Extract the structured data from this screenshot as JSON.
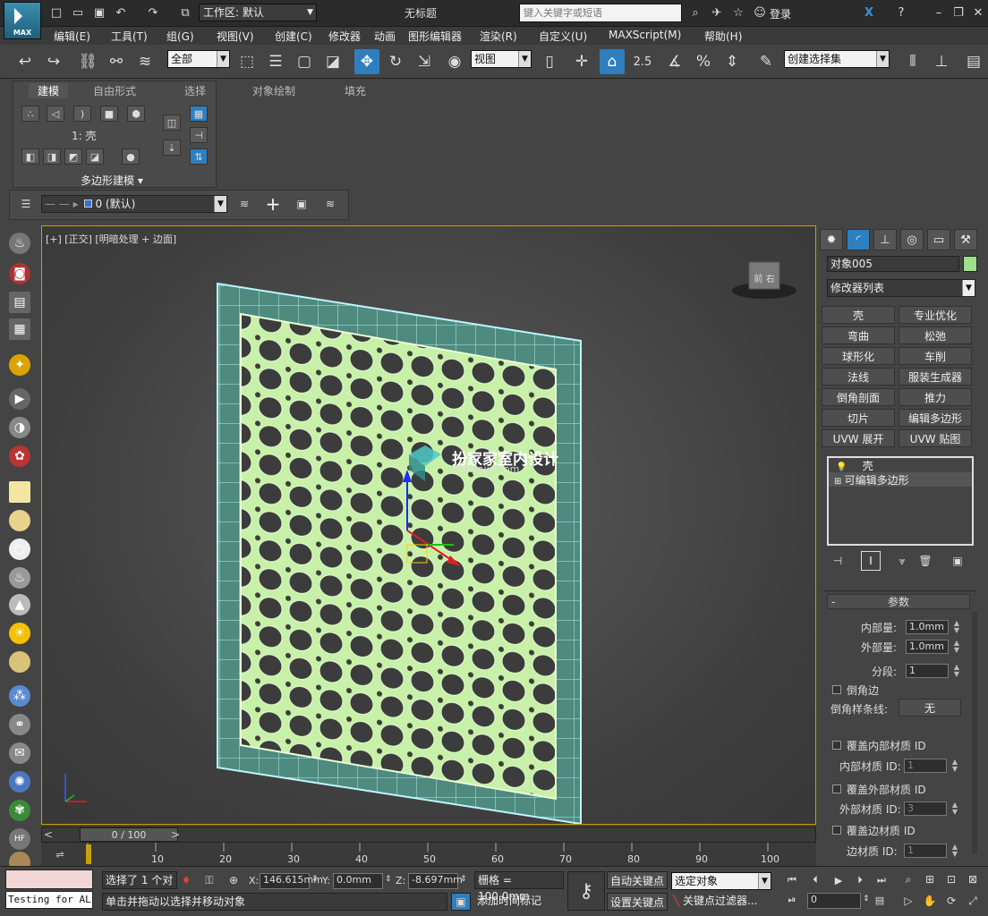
{
  "app": {
    "brand": "MAX",
    "doc_title": "无标题"
  },
  "quick_access": {
    "workspace_label": "工作区: 默认",
    "search_placeholder": "键入关键字或短语",
    "login": "登录"
  },
  "menu": [
    "编辑(E)",
    "工具(T)",
    "组(G)",
    "视图(V)",
    "创建(C)",
    "修改器",
    "动画",
    "图形编辑器",
    "渲染(R)",
    "自定义(U)",
    "MAXScript(M)",
    "帮助(H)"
  ],
  "toolbar": {
    "selection_filter": "全部",
    "ref_coord": "视图",
    "snap_value": "2.5",
    "named_selection": "创建选择集"
  },
  "ribbon": {
    "tabs": [
      "建模",
      "自由形式",
      "选择",
      "对象绘制",
      "填充"
    ],
    "active_tab": "建模",
    "level_label": "1: 壳",
    "panel_title": "多边形建模 ▾"
  },
  "layer": {
    "current": "0 (默认)"
  },
  "viewport": {
    "label": "[+] [正交] [明暗处理 + 边面]",
    "watermark_cn": "扮家家室内设计",
    "watermark_en": "banjiajia.com",
    "viewcube": "前 右"
  },
  "command_panel": {
    "object_name": "对象005",
    "modifier_list": "修改器列表",
    "modifier_buttons": [
      "壳",
      "专业优化",
      "弯曲",
      "松弛",
      "球形化",
      "车削",
      "法线",
      "服装生成器",
      "倒角剖面",
      "推力",
      "切片",
      "编辑多边形",
      "UVW 展开",
      "UVW 贴图"
    ],
    "stack": [
      "壳",
      "可编辑多边形"
    ],
    "params": {
      "rollout_title": "参数",
      "inner_label": "内部量:",
      "inner_value": "1.0mm",
      "outer_label": "外部量:",
      "outer_value": "1.0mm",
      "segments_label": "分段:",
      "segments_value": "1",
      "bevel_edges": "倒角边",
      "bevel_spline_label": "倒角样条线:",
      "bevel_spline_value": "无",
      "override_inner": "覆盖内部材质 ID",
      "inner_mat_label": "内部材质 ID:",
      "inner_mat_value": "1",
      "override_outer": "覆盖外部材质 ID",
      "outer_mat_label": "外部材质 ID:",
      "outer_mat_value": "3",
      "override_edge": "覆盖边材质 ID",
      "edge_mat_label": "边材质 ID:",
      "edge_mat_value": "1"
    }
  },
  "timeline": {
    "frame_label": "0 / 100",
    "ticks": [
      "10",
      "20",
      "30",
      "40",
      "50",
      "60",
      "70",
      "80",
      "90",
      "100"
    ]
  },
  "status": {
    "maxscript_text": "Testing for AL(",
    "selection_info": "选择了 1 个对",
    "prompt": "单击并拖动以选择并移动对象",
    "x_value": "146.615mm",
    "y_value": "0.0mm",
    "z_value": "-8.697mm",
    "grid": "栅格 = 100.0mm",
    "add_time_tag": "添加时间标记",
    "auto_key": "自动关键点",
    "set_key": "设置关键点",
    "key_mode": "选定对象",
    "key_filters": "关键点过滤器...",
    "frame_value": "0"
  }
}
